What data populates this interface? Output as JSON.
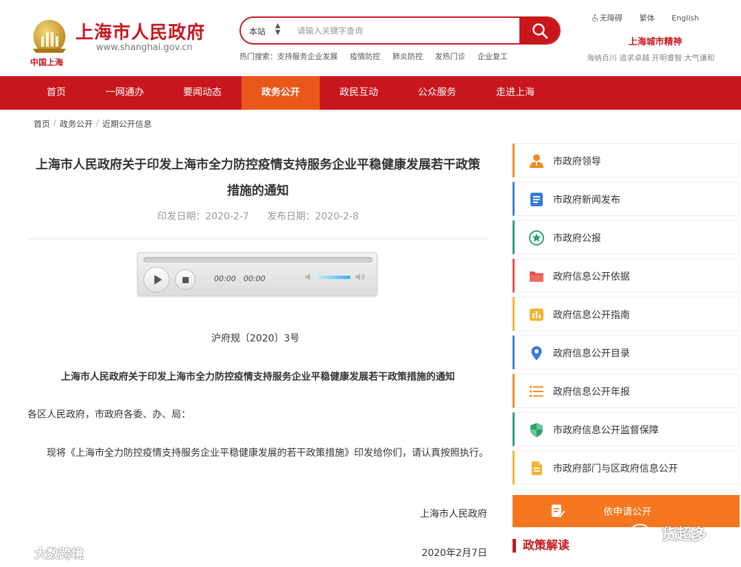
{
  "header": {
    "logo_caption": "中国上海",
    "site_title": "上海市人民政府",
    "site_url": "www.shanghai.gov.cn",
    "search": {
      "scope": "本站",
      "placeholder": "请输入关键字查询",
      "hot_label": "热门搜索：",
      "hot_terms": [
        "支持服务企业发展",
        "疫情防控",
        "肺炎防控",
        "发热门诊",
        "企业复工"
      ]
    },
    "top_links": [
      "无障碍",
      "繁体",
      "English"
    ],
    "city_spirit_title": "上海城市精神",
    "city_spirit_text": "海纳百川 追求卓越 开明睿智 大气谦和"
  },
  "nav": {
    "items": [
      "首页",
      "一网通办",
      "要闻动态",
      "政务公开",
      "政民互动",
      "公众服务",
      "走进上海"
    ],
    "active_index": 3
  },
  "breadcrumb": [
    "首页",
    "政务公开",
    "近期公开信息"
  ],
  "article": {
    "title_line1": "上海市人民政府关于印发上海市全力防控疫情支持服务企业平稳健康发展若干政策",
    "title_line2": "措施的通知",
    "issue_date": "印发日期：2020-2-7",
    "publish_date": "发布日期：2020-2-8",
    "audio": {
      "current_time": "00:00",
      "duration": "00:00",
      "volume": 0.6
    },
    "doc_number": "沪府规〔2020〕3号",
    "sub_title": "上海市人民政府关于印发上海市全力防控疫情支持服务企业平稳健康发展若干政策措施的通知",
    "recipients": "各区人民政府，市政府各委、办、局：",
    "body_text": "现将《上海市全力防控疫情支持服务企业平稳健康发展的若干政策措施》印发给你们，请认真按照执行。",
    "signature": "上海市人民政府",
    "sign_date": "2020年2月7日"
  },
  "sidebar": {
    "items": [
      {
        "label": "市政府领导",
        "icon": "person-icon",
        "color": "#f08a24"
      },
      {
        "label": "市政府新闻发布",
        "icon": "document-icon",
        "color": "#3a7bd5"
      },
      {
        "label": "市政府公报",
        "icon": "star-icon",
        "color": "#2e9e6b"
      },
      {
        "label": "政府信息公开依据",
        "icon": "folder-icon",
        "color": "#e8504a"
      },
      {
        "label": "政府信息公开指南",
        "icon": "chart-icon",
        "color": "#f5b335"
      },
      {
        "label": "政府信息公开目录",
        "icon": "location-pin-icon",
        "color": "#3a7bd5"
      },
      {
        "label": "政府信息公开年报",
        "icon": "list-icon",
        "color": "#f08a24"
      },
      {
        "label": "市政府信息公开监督保障",
        "icon": "shield-icon",
        "color": "#2e9e6b"
      },
      {
        "label": "市政府部门与区政府信息公开",
        "icon": "file-icon",
        "color": "#f5b335"
      }
    ],
    "apply_label": "依申请公开",
    "policy_title": "政策解读"
  },
  "watermarks": {
    "left": "大数跨境",
    "right": "货超多"
  },
  "colors": {
    "brand_red": "#c8161d",
    "nav_active": "#e9571a",
    "apply_orange": "#f6771f"
  }
}
